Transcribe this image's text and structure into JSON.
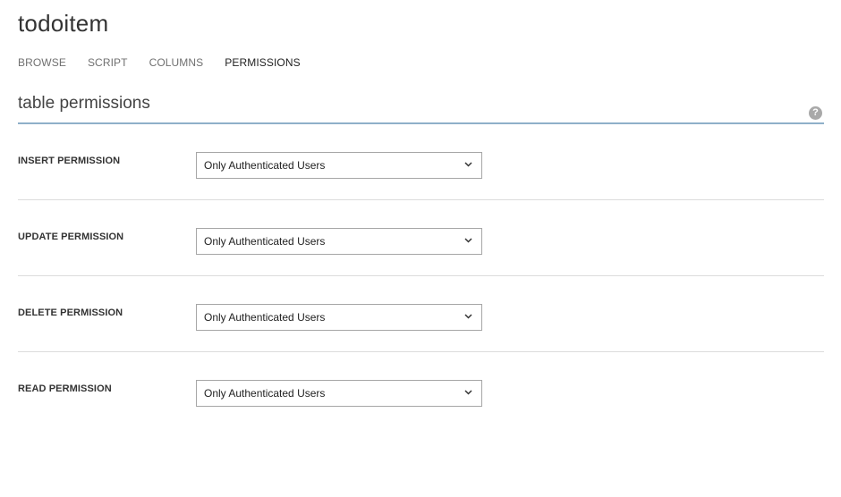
{
  "header": {
    "title": "todoitem"
  },
  "tabs": [
    {
      "label": "BROWSE",
      "active": false
    },
    {
      "label": "SCRIPT",
      "active": false
    },
    {
      "label": "COLUMNS",
      "active": false
    },
    {
      "label": "PERMISSIONS",
      "active": true
    }
  ],
  "section": {
    "title": "table permissions",
    "help_icon": "question-circle-icon",
    "help_glyph": "?"
  },
  "permissions": [
    {
      "label": "INSERT PERMISSION",
      "value": "Only Authenticated Users"
    },
    {
      "label": "UPDATE PERMISSION",
      "value": "Only Authenticated Users"
    },
    {
      "label": "DELETE PERMISSION",
      "value": "Only Authenticated Users"
    },
    {
      "label": "READ PERMISSION",
      "value": "Only Authenticated Users"
    }
  ],
  "colors": {
    "section_underline": "#8fb0c9",
    "divider": "#dcdcdc",
    "help_icon_bg": "#a9a9a9"
  }
}
